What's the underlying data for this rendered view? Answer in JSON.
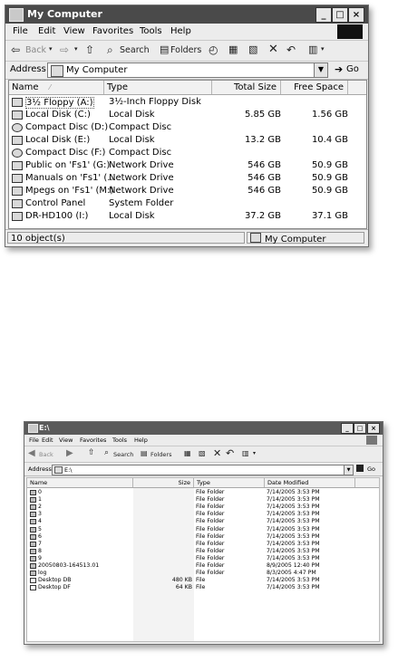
{
  "window1": {
    "title": "My Computer",
    "menu": [
      "File",
      "Edit",
      "View",
      "Favorites",
      "Tools",
      "Help"
    ],
    "toolbar": {
      "back": "Back",
      "search": "Search",
      "folders": "Folders"
    },
    "address": {
      "label": "Address",
      "value": "My Computer",
      "go": "Go"
    },
    "columns": {
      "name": "Name",
      "type": "Type",
      "total": "Total Size",
      "free": "Free Space"
    },
    "rows": [
      {
        "name": "3½ Floppy (A:)",
        "type": "3½-Inch Floppy Disk",
        "total": "",
        "free": "",
        "icon": "floppy-icon"
      },
      {
        "name": "Local Disk (C:)",
        "type": "Local Disk",
        "total": "5.85 GB",
        "free": "1.56 GB",
        "icon": "hard-disk-icon"
      },
      {
        "name": "Compact Disc (D:)",
        "type": "Compact Disc",
        "total": "",
        "free": "",
        "icon": "cd-icon"
      },
      {
        "name": "Local Disk (E:)",
        "type": "Local Disk",
        "total": "13.2 GB",
        "free": "10.4 GB",
        "icon": "hard-disk-icon"
      },
      {
        "name": "Compact Disc (F:)",
        "type": "Compact Disc",
        "total": "",
        "free": "",
        "icon": "cd-icon"
      },
      {
        "name": "Public on 'Fs1' (G:)",
        "type": "Network Drive",
        "total": "546 GB",
        "free": "50.9 GB",
        "icon": "network-drive-icon"
      },
      {
        "name": "Manuals on 'Fs1' (...",
        "type": "Network Drive",
        "total": "546 GB",
        "free": "50.9 GB",
        "icon": "network-drive-icon"
      },
      {
        "name": "Mpegs on 'Fs1' (M:)",
        "type": "Network Drive",
        "total": "546 GB",
        "free": "50.9 GB",
        "icon": "network-drive-icon"
      },
      {
        "name": "Control Panel",
        "type": "System Folder",
        "total": "",
        "free": "",
        "icon": "control-panel-icon"
      },
      {
        "name": "DR-HD100 (I:)",
        "type": "Local Disk",
        "total": "37.2 GB",
        "free": "37.1 GB",
        "icon": "hard-disk-icon"
      }
    ],
    "status": {
      "count": "10 object(s)",
      "location": "My Computer"
    }
  },
  "window2": {
    "title": "E:\\",
    "menu": [
      "File",
      "Edit",
      "View",
      "Favorites",
      "Tools",
      "Help"
    ],
    "toolbar": {
      "back": "Back",
      "search": "Search",
      "folders": "Folders"
    },
    "address": {
      "label": "Address",
      "value": "E:\\",
      "go": "Go"
    },
    "columns": {
      "name": "Name",
      "size": "Size",
      "type": "Type",
      "date": "Date Modified"
    },
    "rows": [
      {
        "name": "0",
        "size": "",
        "type": "File Folder",
        "date": "7/14/2005 3:53 PM",
        "icon": "folder-icon"
      },
      {
        "name": "1",
        "size": "",
        "type": "File Folder",
        "date": "7/14/2005 3:53 PM",
        "icon": "folder-icon"
      },
      {
        "name": "2",
        "size": "",
        "type": "File Folder",
        "date": "7/14/2005 3:53 PM",
        "icon": "folder-icon"
      },
      {
        "name": "3",
        "size": "",
        "type": "File Folder",
        "date": "7/14/2005 3:53 PM",
        "icon": "folder-icon"
      },
      {
        "name": "4",
        "size": "",
        "type": "File Folder",
        "date": "7/14/2005 3:53 PM",
        "icon": "folder-icon"
      },
      {
        "name": "5",
        "size": "",
        "type": "File Folder",
        "date": "7/14/2005 3:53 PM",
        "icon": "folder-icon"
      },
      {
        "name": "6",
        "size": "",
        "type": "File Folder",
        "date": "7/14/2005 3:53 PM",
        "icon": "folder-icon"
      },
      {
        "name": "7",
        "size": "",
        "type": "File Folder",
        "date": "7/14/2005 3:53 PM",
        "icon": "folder-icon"
      },
      {
        "name": "8",
        "size": "",
        "type": "File Folder",
        "date": "7/14/2005 3:53 PM",
        "icon": "folder-icon"
      },
      {
        "name": "9",
        "size": "",
        "type": "File Folder",
        "date": "7/14/2005 3:53 PM",
        "icon": "folder-icon"
      },
      {
        "name": "20050803-164513.01",
        "size": "",
        "type": "File Folder",
        "date": "8/9/2005 12:40 PM",
        "icon": "folder-icon"
      },
      {
        "name": "log",
        "size": "",
        "type": "File Folder",
        "date": "8/3/2005 4:47 PM",
        "icon": "folder-icon"
      },
      {
        "name": "Desktop DB",
        "size": "480 KB",
        "type": "File",
        "date": "7/14/2005 3:53 PM",
        "icon": "file-icon"
      },
      {
        "name": "Desktop DF",
        "size": "64 KB",
        "type": "File",
        "date": "7/14/2005 3:53 PM",
        "icon": "file-icon"
      }
    ]
  }
}
